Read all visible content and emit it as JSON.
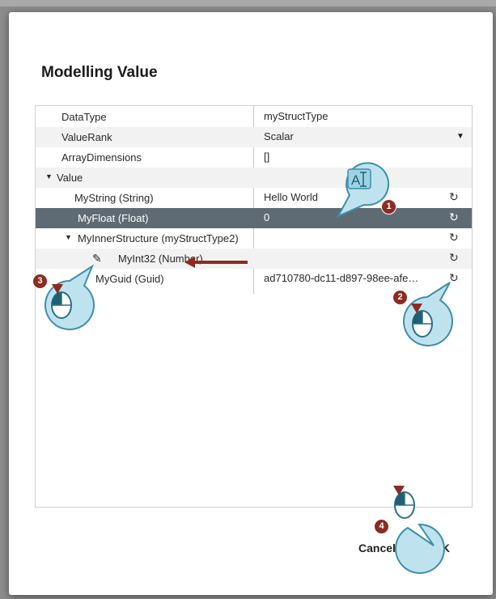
{
  "dialog": {
    "title": "Modelling Value"
  },
  "grid": {
    "rows": [
      {
        "name": "DataType",
        "value": "myStructType"
      },
      {
        "name": "ValueRank",
        "value": "Scalar"
      },
      {
        "name": "ArrayDimensions",
        "value": "[]"
      },
      {
        "name": "Value",
        "toggle": "▼"
      },
      {
        "name": "MyString (String)",
        "value": "Hello World",
        "refresh": "↻"
      },
      {
        "name": "MyFloat (Float)",
        "value": "0",
        "refresh": "↻"
      },
      {
        "name": "MyInnerStructure (myStructType2)",
        "toggle": "▼",
        "refresh": "↻"
      },
      {
        "name": "MyInt32 (Number)",
        "refresh": "↻"
      },
      {
        "name": "MyGuid (Guid)",
        "value": "ad710780-dc11-d897-98ee-afe…",
        "refresh": "↻"
      }
    ]
  },
  "buttons": {
    "cancel": "Cancel",
    "ok": "OK"
  },
  "annotations": {
    "badges": [
      "1",
      "2",
      "3",
      "4"
    ],
    "type_cursor_icon": "text-cursor-icon",
    "mouse_icon": "mouse-click-icon"
  },
  "colors": {
    "accent": "#8b2b22",
    "selected_row": "#5f6b74",
    "callout": "#bfe3ee",
    "callout_border": "#3d8fa8"
  }
}
